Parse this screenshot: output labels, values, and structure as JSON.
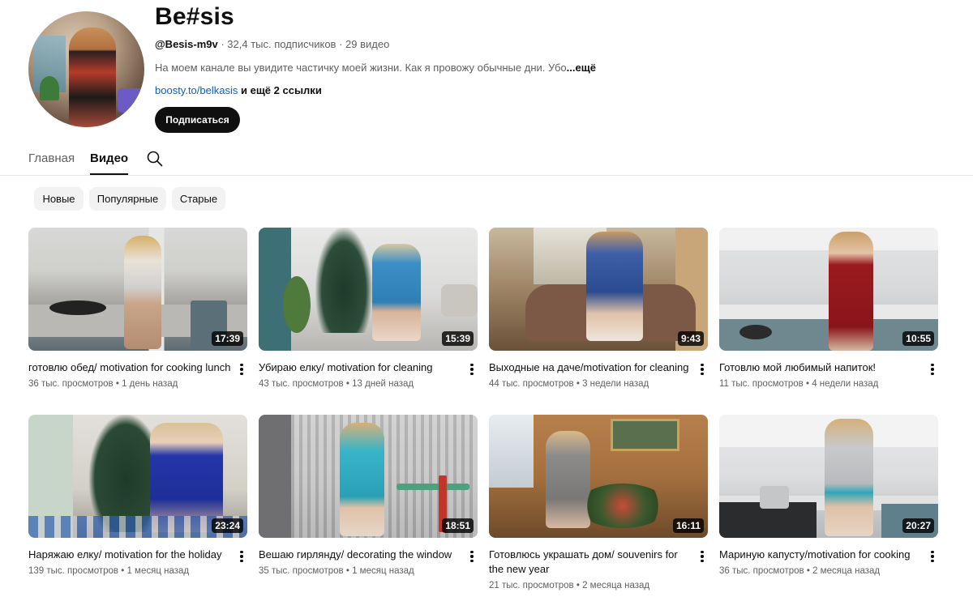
{
  "channel": {
    "name": "Be#sis",
    "handle": "@Besis-m9v",
    "subscribers": "32,4 тыс. подписчиков",
    "videos_count": "29 видео",
    "description": "На моем канале вы увидите частичку моей жизни. Как я провожу обычные дни. Убо",
    "description_more": "...ещё",
    "link": "boosty.to/belkasis",
    "more_links": "и ещё 2 ссылки",
    "subscribe_label": "Подписаться"
  },
  "tabs": [
    {
      "label": "Главная",
      "active": false
    },
    {
      "label": "Видео",
      "active": true
    }
  ],
  "chips": [
    {
      "label": "Новые"
    },
    {
      "label": "Популярные"
    },
    {
      "label": "Старые"
    }
  ],
  "videos": [
    {
      "title": "готовлю обед/ motivation for cooking lunch",
      "views": "36 тыс. просмотров",
      "age": "1 день назад",
      "duration": "17:39"
    },
    {
      "title": "Убираю елку/ motivation for cleaning",
      "views": "43 тыс. просмотров",
      "age": "13 дней назад",
      "duration": "15:39"
    },
    {
      "title": "Выходные на даче/motivation for cleaning",
      "views": "44 тыс. просмотров",
      "age": "3 недели назад",
      "duration": "9:43"
    },
    {
      "title": "Готовлю мой любимый напиток!",
      "views": "11 тыс. просмотров",
      "age": "4 недели назад",
      "duration": "10:55"
    },
    {
      "title": "Наряжаю елку/ motivation for the holiday",
      "views": "139 тыс. просмотров",
      "age": "1 месяц назад",
      "duration": "23:24"
    },
    {
      "title": "Вешаю гирлянду/ decorating the window",
      "views": "35 тыс. просмотров",
      "age": "1 месяц назад",
      "duration": "18:51"
    },
    {
      "title": "Готовлюсь украшать дом/ souvenirs for the new year",
      "views": "21 тыс. просмотров",
      "age": "2 месяца назад",
      "duration": "16:11"
    },
    {
      "title": "Мариную капусту/motivation for cooking",
      "views": "36 тыс. просмотров",
      "age": "2 месяца назад",
      "duration": "20:27"
    }
  ],
  "icons": {
    "search": "search-icon",
    "menu": "more-vert-icon"
  }
}
